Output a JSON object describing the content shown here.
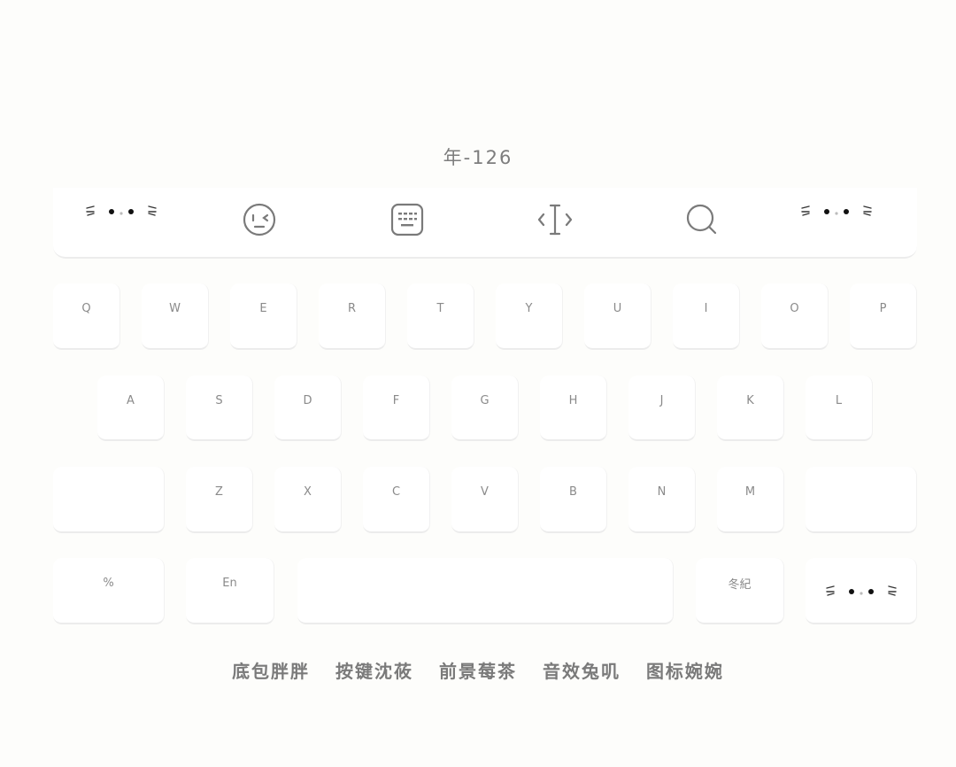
{
  "title": "年-126",
  "toolbar": {
    "icons": [
      "cat-face-icon",
      "emoji-face-icon",
      "keyboard-icon",
      "cursor-icon",
      "search-icon",
      "cat-face-icon"
    ]
  },
  "keyboard": {
    "row1": [
      "Q",
      "W",
      "E",
      "R",
      "T",
      "Y",
      "U",
      "I",
      "O",
      "P"
    ],
    "row2": [
      "A",
      "S",
      "D",
      "F",
      "G",
      "H",
      "J",
      "K",
      "L"
    ],
    "row3": [
      "Z",
      "X",
      "C",
      "V",
      "B",
      "N",
      "M"
    ],
    "row4": {
      "symbol": "%",
      "lang": "En",
      "space": "",
      "author": "冬紀"
    }
  },
  "credits": [
    "底包胖胖",
    "按键沈莜",
    "前景莓茶",
    "音效兔叽",
    "图标婉婉"
  ]
}
